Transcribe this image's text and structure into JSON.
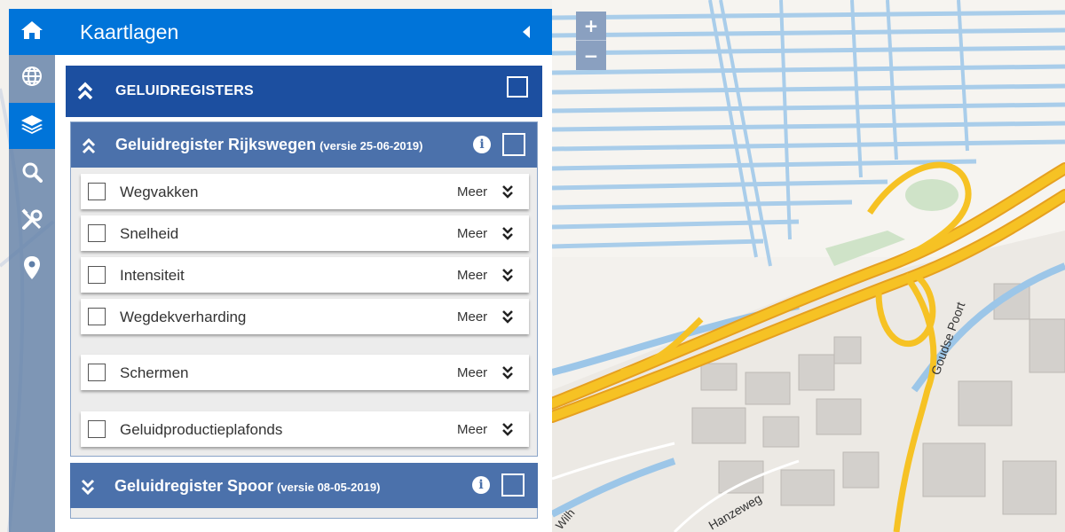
{
  "panel": {
    "title": "Kaartlagen",
    "group": {
      "label": "GELUIDREGISTERS",
      "subgroups": [
        {
          "name": "Geluidregister Rijkswegen",
          "version": "(versie 25-06-2019)",
          "layers": [
            {
              "name": "Wegvakken",
              "more": "Meer"
            },
            {
              "name": "Snelheid",
              "more": "Meer"
            },
            {
              "name": "Intensiteit",
              "more": "Meer"
            },
            {
              "name": "Wegdekverharding",
              "more": "Meer"
            },
            {
              "name": "Schermen",
              "more": "Meer"
            },
            {
              "name": "Geluidproductieplafonds",
              "more": "Meer"
            }
          ]
        },
        {
          "name": "Geluidregister Spoor",
          "version": "(versie 08-05-2019)"
        }
      ]
    }
  },
  "map": {
    "zoom_in": "+",
    "zoom_out": "−",
    "labels": {
      "goudse_poort": "Goudse Poort",
      "hanzeweg": "Hanzeweg",
      "wilh": "Wilh"
    }
  },
  "rail": {
    "icons": [
      "home-icon",
      "globe-icon",
      "layers-icon",
      "search-icon",
      "tools-icon",
      "map-pin-icon"
    ],
    "active": "layers-icon"
  },
  "colors": {
    "primary": "#0074d9",
    "group": "#1c4fa0",
    "subgroup": "#4b71ab",
    "water": "#9cc6e8",
    "highway": "#f6c224"
  }
}
